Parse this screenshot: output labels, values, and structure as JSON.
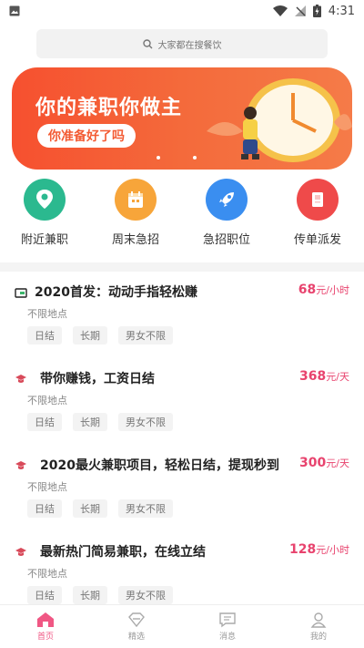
{
  "status_bar": {
    "time": "4:31"
  },
  "search": {
    "placeholder": "大家都在搜餐饮"
  },
  "banner": {
    "title": "你的兼职你做主",
    "subtitle": "你准备好了吗"
  },
  "categories": [
    {
      "label": "附近兼职",
      "color": "#2bb98f",
      "icon": "location-pin-icon"
    },
    {
      "label": "周末急招",
      "color": "#f7a53a",
      "icon": "calendar-icon"
    },
    {
      "label": "急招职位",
      "color": "#3a8ef0",
      "icon": "rocket-icon"
    },
    {
      "label": "传单派发",
      "color": "#ef4a4a",
      "icon": "flyer-icon"
    }
  ],
  "jobs": [
    {
      "title": "2020首发：动动手指轻松赚",
      "amount": "68",
      "unit": "元/小时",
      "location": "不限地点",
      "tags": [
        "日结",
        "长期",
        "男女不限"
      ]
    },
    {
      "title": "带你赚钱，工资日结",
      "amount": "368",
      "unit": "元/天",
      "location": "不限地点",
      "tags": [
        "日结",
        "长期",
        "男女不限"
      ]
    },
    {
      "title": "2020最火兼职项目，轻松日结，提现秒到",
      "amount": "300",
      "unit": "元/天",
      "location": "不限地点",
      "tags": [
        "日结",
        "长期",
        "男女不限"
      ]
    },
    {
      "title": "最新热门简易兼职，在线立结",
      "amount": "128",
      "unit": "元/小时",
      "location": "不限地点",
      "tags": [
        "日结",
        "长期",
        "男女不限"
      ]
    }
  ],
  "bottom_nav": [
    {
      "label": "首页",
      "icon": "home-icon",
      "active": true
    },
    {
      "label": "精选",
      "icon": "diamond-icon",
      "active": false
    },
    {
      "label": "消息",
      "icon": "message-icon",
      "active": false
    },
    {
      "label": "我的",
      "icon": "user-icon",
      "active": false
    }
  ],
  "colors": {
    "accent": "#f05784",
    "pay": "#e8436e",
    "banner": "#f6502f"
  }
}
